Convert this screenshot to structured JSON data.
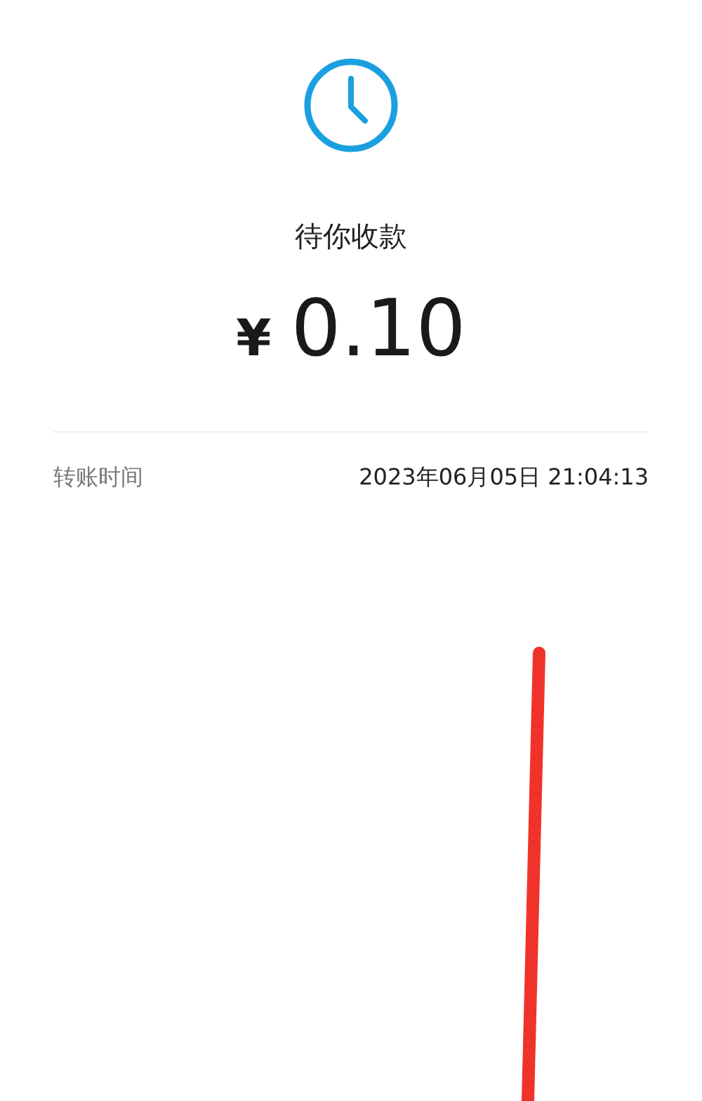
{
  "status": "待你收款",
  "amount": {
    "currency": "¥",
    "value": "0.10"
  },
  "details": [
    {
      "label": "转账时间",
      "value": "2023年06月05日 21:04:13"
    }
  ]
}
